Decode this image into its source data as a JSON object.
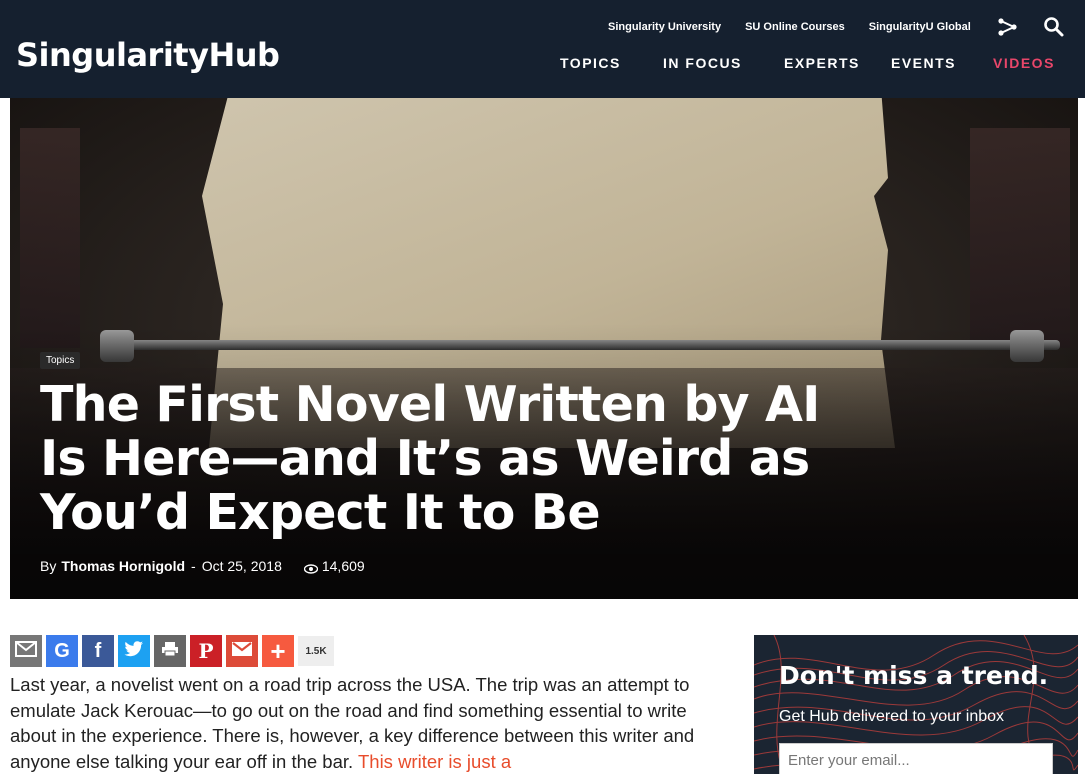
{
  "header": {
    "logo": "SingularityHub",
    "top_links": [
      "Singularity University",
      "SU Online Courses",
      "SingularityU Global"
    ],
    "nav": [
      "TOPICS",
      "IN FOCUS",
      "EXPERTS",
      "EVENTS",
      "VIDEOS"
    ],
    "icons": [
      "share-icon",
      "search-icon"
    ],
    "videos_color": "#e8466a",
    "background": "#15202f"
  },
  "hero": {
    "tag": "Topics",
    "headline": "The First Novel Written by AI Is Here—and It’s as Weird as You’d Expect It to Be",
    "byline_prefix": "By",
    "author": "Thomas Hornigold",
    "separator": "-",
    "date": "Oct 25, 2018",
    "views": "14,609"
  },
  "share": {
    "buttons": [
      {
        "name": "email",
        "color": "#777777"
      },
      {
        "name": "google",
        "color": "#3b7bec"
      },
      {
        "name": "facebook",
        "color": "#3b5998"
      },
      {
        "name": "twitter",
        "color": "#1da1f2"
      },
      {
        "name": "print",
        "color": "#666666"
      },
      {
        "name": "pinterest",
        "color": "#cb2027"
      },
      {
        "name": "gmail",
        "color": "#dd4b39"
      },
      {
        "name": "more",
        "color": "#f65a3f"
      }
    ],
    "count": "1.5K"
  },
  "article": {
    "text": "Last year, a novelist went on a road trip across the USA. The trip was an attempt to emulate Jack Kerouac—to go out on the road and find something essential to write about in the experience. There is, however, a key difference between this writer and anyone else talking your ear off in the bar.",
    "link_text": "This writer is just a",
    "link_color": "#e84c2b"
  },
  "newsletter": {
    "title": "Don't miss a trend.",
    "subtitle": "Get Hub delivered to your inbox",
    "placeholder": "Enter your email..."
  }
}
